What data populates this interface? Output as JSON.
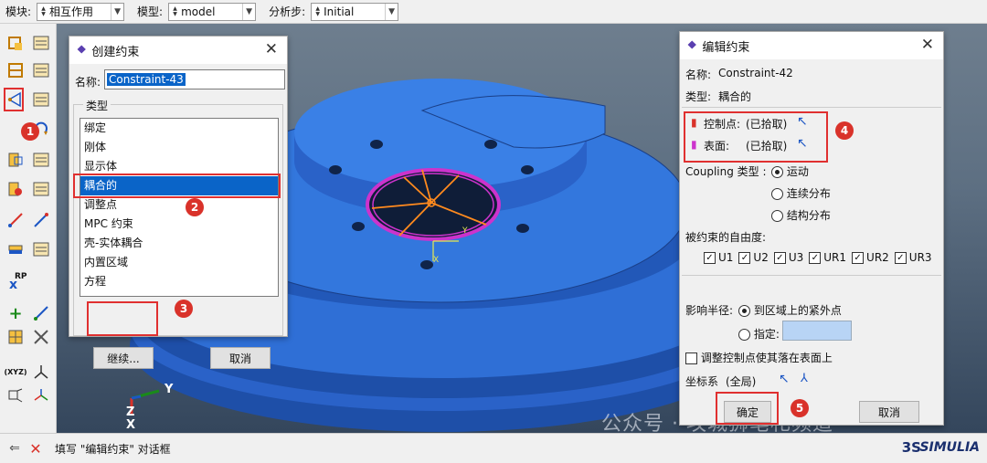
{
  "toolbar": {
    "module_label": "模块:",
    "module_value": "相互作用",
    "model_label": "模型:",
    "model_value": "model",
    "step_label": "分析步:",
    "step_value": "Initial"
  },
  "viewport": {
    "triad_y": "Y",
    "triad_z": "Z",
    "triad_x": "X",
    "mini_y": "Y",
    "mini_x": "X",
    "mini_z": "Z",
    "rp_label": "RP"
  },
  "create_dialog": {
    "title": "创建约束",
    "name_label": "名称:",
    "name_value": "Constraint-43",
    "type_group": "类型",
    "types": [
      "绑定",
      "刚体",
      "显示体",
      "耦合的",
      "调整点",
      "MPC 约束",
      "壳-实体耦合",
      "内置区域",
      "方程"
    ],
    "selected_index": 3,
    "continue_button": "继续...",
    "cancel_button": "取消"
  },
  "edit_dialog": {
    "title": "编辑约束",
    "name_label": "名称:",
    "name_value": "Constraint-42",
    "type_label": "类型:",
    "type_value": "耦合的",
    "control_point_label": "控制点:",
    "control_point_status": "(已拾取)",
    "surface_label": "表面:",
    "surface_status": "(已拾取)",
    "coupling_type_label": "Coupling 类型 :",
    "coupling_options": [
      "运动",
      "连续分布",
      "结构分布"
    ],
    "coupling_selected": 0,
    "dof_label": "被约束的自由度:",
    "dofs": [
      "U1",
      "U2",
      "U3",
      "UR1",
      "UR2",
      "UR3"
    ],
    "radius_label": "影响半径:",
    "radius_option1": "到区域上的紧外点",
    "radius_option2": "指定:",
    "adjust_label": "调整控制点使其落在表面上",
    "csys_label": "坐标系",
    "csys_value": "(全局)",
    "ok_button": "确定",
    "cancel_button": "取消"
  },
  "badges": [
    "1",
    "2",
    "3",
    "4",
    "5"
  ],
  "status": {
    "text": "填写 \"编辑约束\" 对话框",
    "brand": "SIMULIA"
  },
  "watermark": "公众号 · 攻城狮笔札频道",
  "colors": {
    "part": "#2f6fd6",
    "selection": "#0a64c8",
    "annotation": "#d9322a",
    "magenta": "#cc33cc"
  }
}
